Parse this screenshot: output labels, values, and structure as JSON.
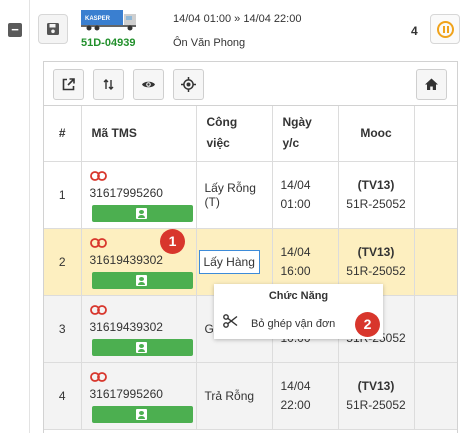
{
  "vehicle": {
    "plate": "51D-04939",
    "truck_brand": "KASPER",
    "time_range": "14/04 01:00 » 14/04 22:00",
    "place": "Ôn Văn Phong",
    "count": "4",
    "colors": {
      "plate": "#22902c",
      "pause": "#f0a31c"
    }
  },
  "toolbar": {
    "buttons": [
      "open-external-icon",
      "sort-icon",
      "eye-icon",
      "target-icon",
      "home-icon"
    ]
  },
  "table": {
    "headers": {
      "index": "#",
      "tms": "Mã TMS",
      "work": [
        "Công",
        "việc"
      ],
      "date": [
        "Ngày",
        "y/c"
      ],
      "mooc": "Mooc"
    },
    "rows": [
      {
        "index": "1",
        "tms": "31617995260",
        "work": [
          "Lấy Rỗng",
          "(T)"
        ],
        "date": [
          "14/04",
          "01:00"
        ],
        "mooc_code": "(TV13)",
        "mooc_plate": "51R-25052"
      },
      {
        "index": "2",
        "tms": "31619439302",
        "work": [
          "Lấy Hàng"
        ],
        "date": [
          "14/04",
          "16:00"
        ],
        "mooc_code": "(TV13)",
        "mooc_plate": "51R-25052"
      },
      {
        "index": "3",
        "tms": "31619439302",
        "work": [
          "Gi"
        ],
        "date": [
          "",
          "10:00"
        ],
        "mooc_code": "3)",
        "mooc_plate": "51R-25052"
      },
      {
        "index": "4",
        "tms": "31617995260",
        "work": [
          "Trả Rỗng"
        ],
        "date": [
          "14/04",
          "22:00"
        ],
        "mooc_code": "(TV13)",
        "mooc_plate": "51R-25052"
      }
    ]
  },
  "context_menu": {
    "title": "Chức Năng",
    "item_label": "Bỏ ghép vận đơn"
  },
  "badges": [
    "1",
    "2"
  ]
}
